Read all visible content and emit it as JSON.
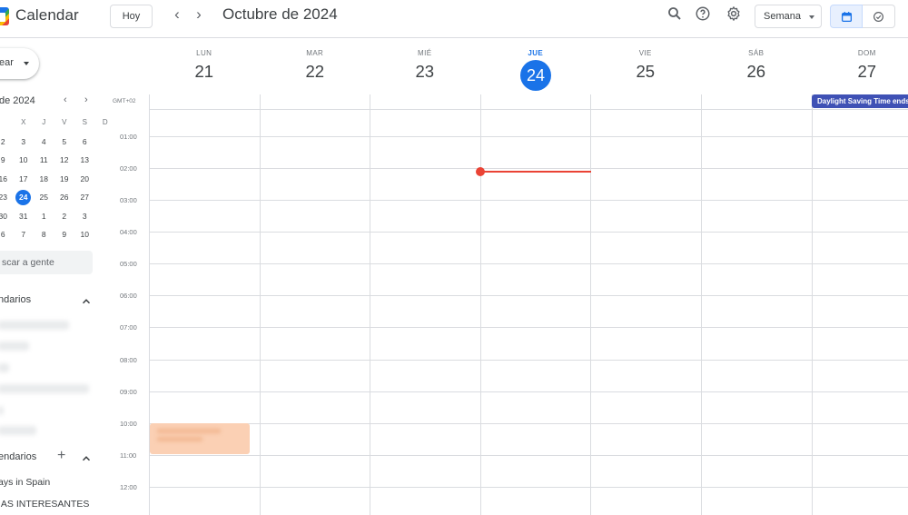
{
  "header": {
    "app_title": "Calendar",
    "today_label": "Hoy",
    "prev_arrow": "‹",
    "next_arrow": "›",
    "month_title": "Octubre de 2024",
    "view_selector": "Semana",
    "icons": [
      "search-icon",
      "help-icon",
      "settings-icon",
      "calendar-view-icon",
      "tasks-view-icon"
    ],
    "accent_color": "#1a73e8"
  },
  "sidebar": {
    "create_label": "ear",
    "mini_calendar": {
      "title": "de 2024",
      "prev": "‹",
      "next": "›",
      "weekday_headers": [
        "",
        "X",
        "J",
        "V",
        "S",
        "D"
      ],
      "weeks": [
        [
          "2",
          "3",
          "4",
          "5",
          "6"
        ],
        [
          "9",
          "10",
          "11",
          "12",
          "13"
        ],
        [
          "16",
          "17",
          "18",
          "19",
          "20"
        ],
        [
          "23",
          "24",
          "25",
          "26",
          "27"
        ],
        [
          "30",
          "31",
          "1",
          "2",
          "3"
        ],
        [
          "6",
          "7",
          "8",
          "9",
          "10"
        ]
      ],
      "selected_day": "24"
    },
    "search_people_placeholder": "scar a gente",
    "my_calendars_title": "ndarios",
    "other_calendars_title": "endarios",
    "other_calendars": [
      "ays in Spain",
      "IAS INTERESANTES"
    ]
  },
  "week": {
    "timezone": "GMT+02",
    "days": [
      {
        "name": "LUN",
        "num": "21"
      },
      {
        "name": "MAR",
        "num": "22"
      },
      {
        "name": "MIÉ",
        "num": "23"
      },
      {
        "name": "JUE",
        "num": "24",
        "today": true
      },
      {
        "name": "VIE",
        "num": "25"
      },
      {
        "name": "SÁB",
        "num": "26"
      },
      {
        "name": "DOM",
        "num": "27"
      }
    ],
    "hours": [
      "01:00",
      "02:00",
      "03:00",
      "04:00",
      "05:00",
      "06:00",
      "07:00",
      "08:00",
      "09:00",
      "10:00",
      "11:00",
      "12:00"
    ],
    "allday_event": {
      "title": "Daylight Saving Time ends",
      "day": "DOM",
      "color": "#3f51b5"
    },
    "timed_event": {
      "day": "LUN",
      "start": "10:00",
      "end": "11:00",
      "color": "#fbd0b4"
    },
    "now_indicator": {
      "day": "JUE",
      "time": "02:05",
      "color": "#ea4335"
    }
  }
}
